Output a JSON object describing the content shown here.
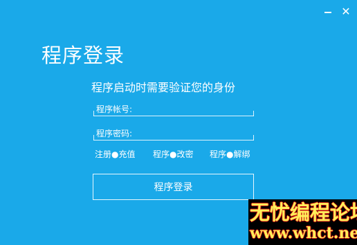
{
  "window": {
    "minimize_icon": "minimize-icon",
    "close_icon": "close-icon",
    "close_glyph": "✕"
  },
  "title": "程序登录",
  "subtitle": "程序启动时需要验证您的身份",
  "form": {
    "account_placeholder": "程序帐号:",
    "account_value": "",
    "password_placeholder": "程序密码:",
    "password_value": ""
  },
  "links": [
    {
      "label": "注册●充值"
    },
    {
      "label": "程序●改密"
    },
    {
      "label": "程序●解绑"
    }
  ],
  "login_button": "程序登录",
  "watermark": {
    "line1": "无忧编程论坛",
    "line2": "www.whct.net"
  },
  "colors": {
    "background": "#1aa9e9",
    "text": "#ffffff"
  }
}
